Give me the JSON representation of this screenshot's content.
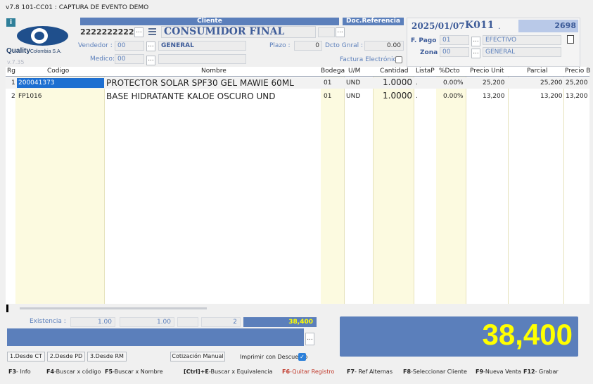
{
  "window": {
    "title": "v7.8 101-CC01 : CAPTURA DE EVENTO DEMO"
  },
  "logo": {
    "name": "Quality",
    "sub": "Colombia S.A.",
    "version": "v.7.35"
  },
  "header": {
    "cliente_label": "Cliente",
    "doc_ref_label": "Doc.Referencia",
    "client_id": "22222222222",
    "client_name": "CONSUMIDOR FINAL",
    "vendedor_label": "Vendedor :",
    "vendedor_code": "00",
    "vendedor_name": "GENERAL",
    "medico_label": "Medico:",
    "medico_code": "00",
    "plazo_label": "Plazo :",
    "plazo_value": "0",
    "dcto_label": "Dcto Gnral :",
    "dcto_value": "0.00",
    "factura_label": "Factura Electrónica"
  },
  "right_panel": {
    "date": "2025/01/07",
    "code": "K011",
    "code_suffix": ".",
    "number": "2698",
    "fpago_label": "F. Pago",
    "fpago_code": "01",
    "fpago_name": "EFECTIVO",
    "zona_label": "Zona",
    "zona_code": "00",
    "zona_name": "GENERAL"
  },
  "table": {
    "columns": [
      "Rg",
      "Codigo",
      "Nombre",
      "Bodega",
      "U/M",
      "Cantidad",
      "ListaP",
      "%Dcto",
      "Precio Unit",
      "Parcial",
      "Precio B"
    ],
    "rows": [
      {
        "rg": "1",
        "codigo": "200041373",
        "nombre": "PROTECTOR SOLAR SPF30 GEL MAWIE 60ML",
        "bodega": "01",
        "um": "UND",
        "cantidad": "1.0000",
        "listap": ".",
        "dcto": "0.00%",
        "precio_unit": "25,200",
        "parcial": "25,200",
        "precio_b": "25,200"
      },
      {
        "rg": "2",
        "codigo": "FP1016",
        "nombre": "BASE HIDRATANTE KALOE OSCURO UND",
        "bodega": "01",
        "um": "UND",
        "cantidad": "1.0000",
        "listap": ".",
        "dcto": "0.00%",
        "precio_unit": "13,200",
        "parcial": "13,200",
        "precio_b": "13,200"
      }
    ]
  },
  "footer": {
    "existencia_label": "Existencia :",
    "exist_1": "1.00",
    "exist_2": "1.00",
    "exist_3": "2",
    "exist_total": "38,400",
    "total": "38,400",
    "buttons": [
      "1.Desde CT",
      "2.Desde PD",
      "3.Desde RM"
    ],
    "cotizacion": "Cotización Manual",
    "imprimir": "Imprimir con Descuento"
  },
  "fkeys": [
    {
      "key": "F3",
      "label": "- Info"
    },
    {
      "key": "F4",
      "label": "-Buscar x código"
    },
    {
      "key": "F5",
      "label": "-Buscar x Nombre"
    },
    {
      "key": "[Ctrl]+E",
      "label": "-Buscar x Equivalencia"
    },
    {
      "key": "F6",
      "label": "-Quitar Registro"
    },
    {
      "key": "F7",
      "label": "- Ref Alternas"
    },
    {
      "key": "F8",
      "label": "-Seleccionar Cliente"
    },
    {
      "key": "F9",
      "label": "-Nueva Venta"
    },
    {
      "key": "F12",
      "label": "- Grabar"
    }
  ],
  "colors": {
    "accent": "#5b7fbb",
    "highlight": "#ffff00",
    "grid_fill": "#fcfae0"
  }
}
